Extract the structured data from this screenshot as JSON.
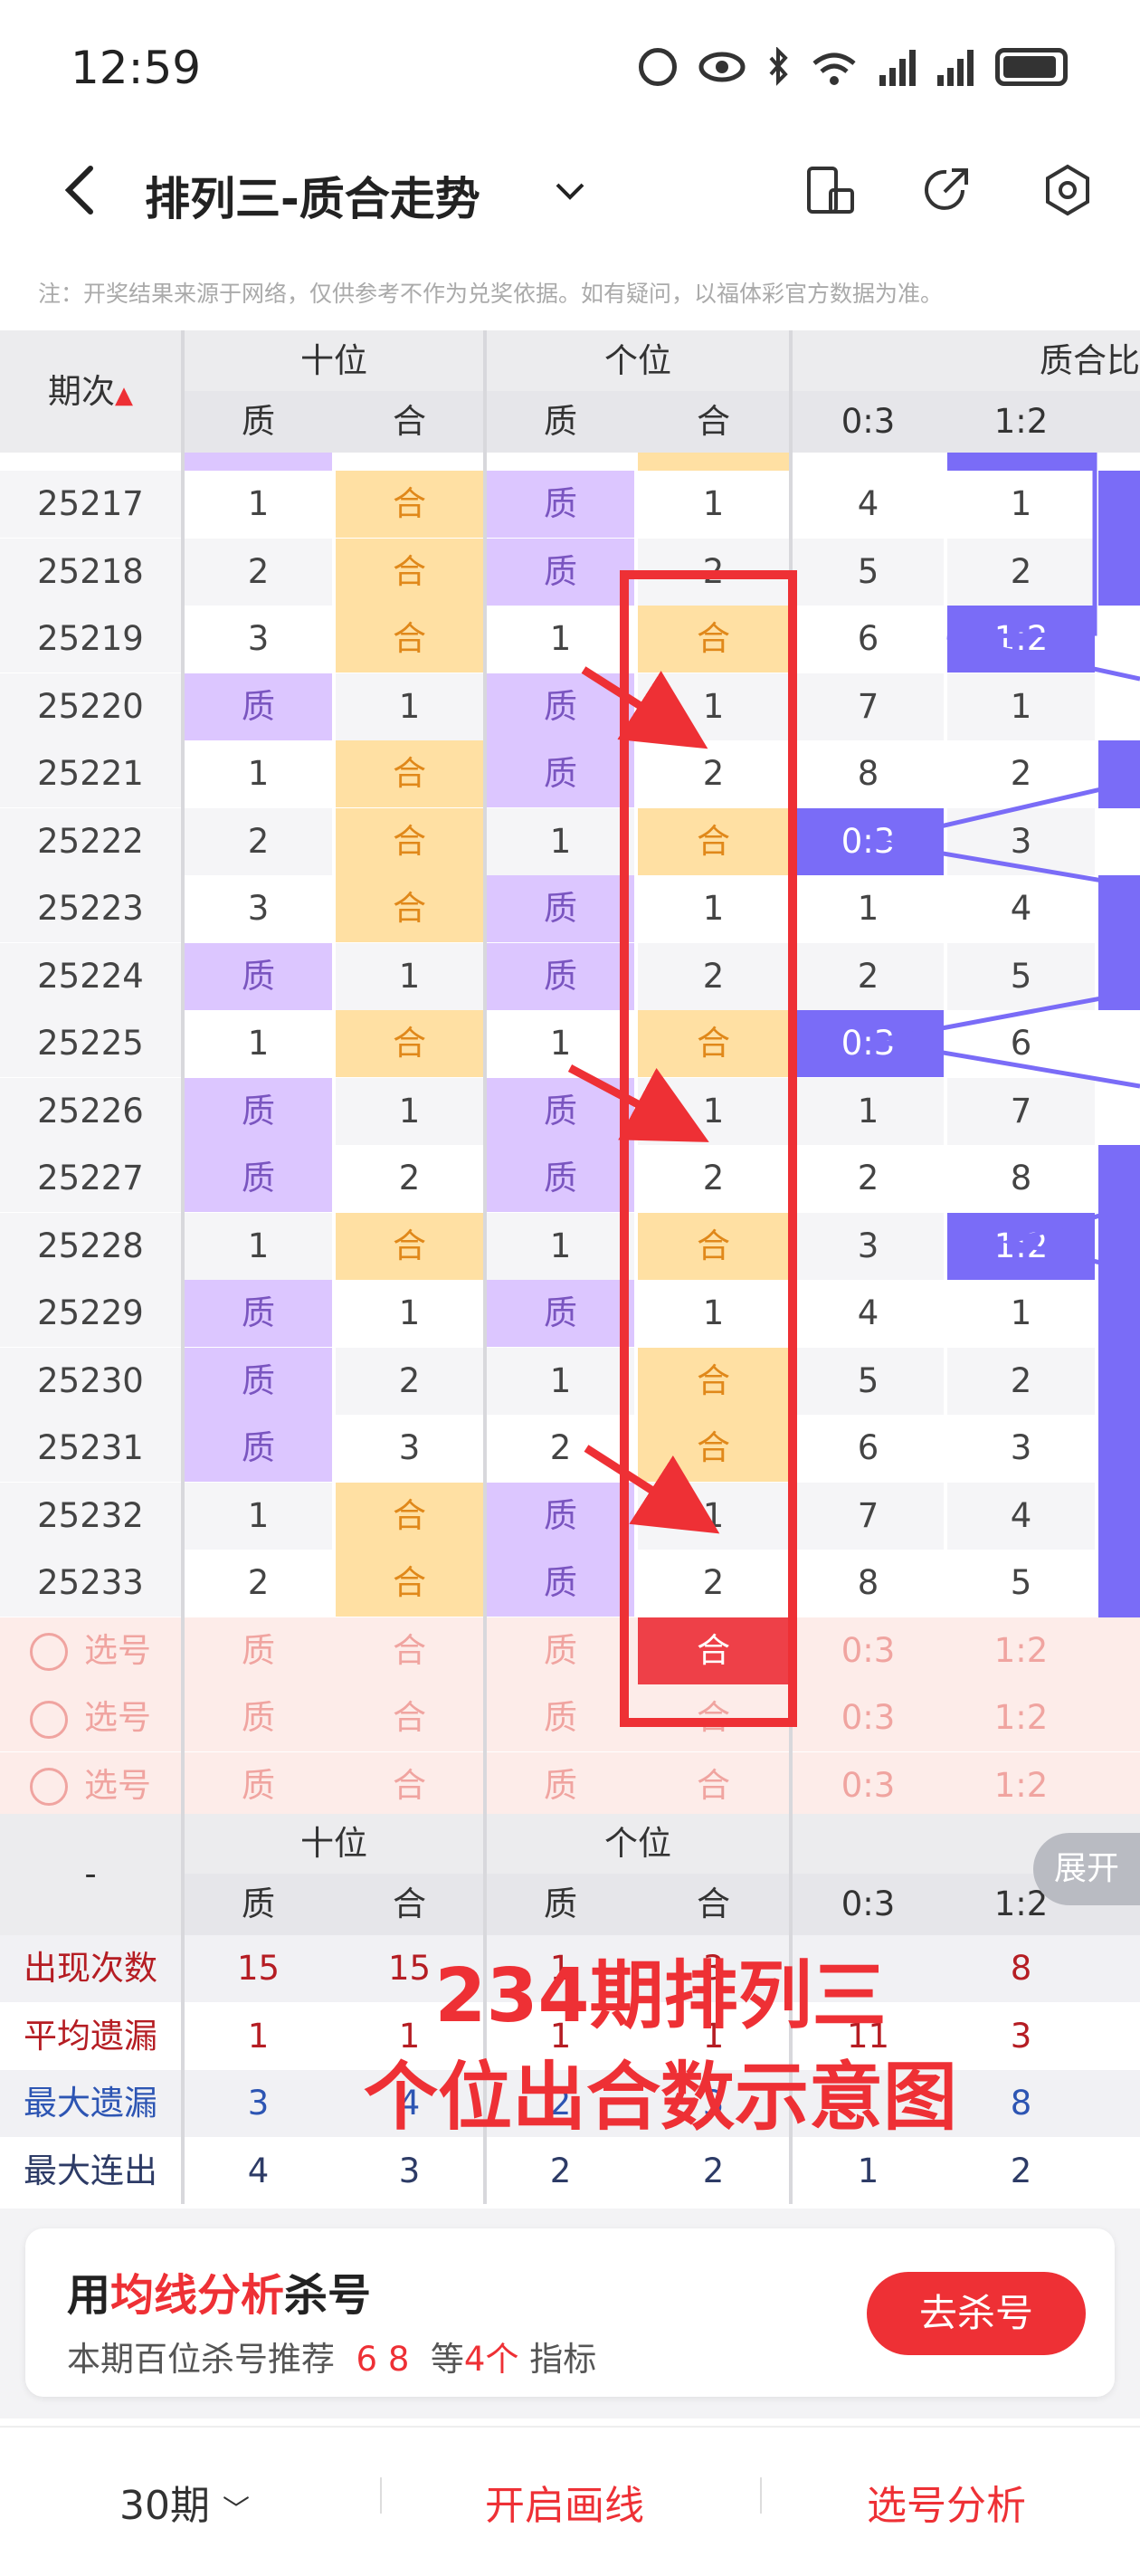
{
  "status": {
    "time": "12:59"
  },
  "header": {
    "title": "排列三-质合走势"
  },
  "notice": "注：开奖结果来源于网络，仅供参考不作为兑奖依据。如有疑问，以福体彩官方数据为准。",
  "table": {
    "period_header": "期次",
    "groups": [
      "十位",
      "个位",
      "质合比"
    ],
    "sub": [
      "质",
      "合",
      "质",
      "合",
      "0:3",
      "1:2"
    ],
    "rows": [
      [
        "25217",
        "1",
        "合",
        "质",
        "1",
        "4",
        "1"
      ],
      [
        "25218",
        "2",
        "合",
        "质",
        "2",
        "5",
        "2"
      ],
      [
        "25219",
        "3",
        "合",
        "1",
        "合",
        "6",
        "1:2"
      ],
      [
        "25220",
        "质",
        "1",
        "质",
        "1",
        "7",
        "1"
      ],
      [
        "25221",
        "1",
        "合",
        "质",
        "2",
        "8",
        "2"
      ],
      [
        "25222",
        "2",
        "合",
        "1",
        "合",
        "0:3",
        "3"
      ],
      [
        "25223",
        "3",
        "合",
        "质",
        "1",
        "1",
        "4"
      ],
      [
        "25224",
        "质",
        "1",
        "质",
        "2",
        "2",
        "5"
      ],
      [
        "25225",
        "1",
        "合",
        "1",
        "合",
        "0:3",
        "6"
      ],
      [
        "25226",
        "质",
        "1",
        "质",
        "1",
        "1",
        "7"
      ],
      [
        "25227",
        "质",
        "2",
        "质",
        "2",
        "2",
        "8"
      ],
      [
        "25228",
        "1",
        "合",
        "1",
        "合",
        "3",
        "1:2"
      ],
      [
        "25229",
        "质",
        "1",
        "质",
        "1",
        "4",
        "1"
      ],
      [
        "25230",
        "质",
        "2",
        "1",
        "合",
        "5",
        "2"
      ],
      [
        "25231",
        "质",
        "3",
        "2",
        "合",
        "6",
        "3"
      ],
      [
        "25232",
        "1",
        "合",
        "质",
        "1",
        "7",
        "4"
      ],
      [
        "25233",
        "2",
        "合",
        "质",
        "2",
        "8",
        "5"
      ]
    ],
    "select_label": "选号",
    "select_rows": [
      [
        "质",
        "合",
        "质",
        "合",
        "0:3",
        "1:2"
      ],
      [
        "质",
        "合",
        "质",
        "合",
        "0:3",
        "1:2"
      ],
      [
        "质",
        "合",
        "质",
        "合",
        "0:3",
        "1:2"
      ]
    ],
    "footer_dash": "-",
    "footer_groups": [
      "十位",
      "个位"
    ],
    "expand": "展开",
    "stats": [
      {
        "label": "出现次数",
        "values": [
          "15",
          "15",
          "1",
          "3",
          "",
          "8"
        ]
      },
      {
        "label": "平均遗漏",
        "values": [
          "1",
          "1",
          "1",
          "1",
          "11",
          "3"
        ]
      },
      {
        "label": "最大遗漏",
        "values": [
          "3",
          "4",
          "2",
          "3",
          "",
          "8"
        ]
      },
      {
        "label": "最大连出",
        "values": [
          "4",
          "3",
          "2",
          "2",
          "1",
          "2"
        ]
      }
    ]
  },
  "annotation": {
    "line1": "234期排列三",
    "line2": "个位出合数示意图"
  },
  "promo": {
    "prefix": "用",
    "highlight": "均线分析",
    "suffix": "杀号",
    "sub_prefix": "本期百位杀号推荐",
    "sub_nums": "6 8",
    "sub_mid": "等",
    "sub_count": "4个",
    "sub_suffix": "指标",
    "button": "去杀号"
  },
  "bottom": {
    "periods": "30期",
    "draw": "开启画线",
    "analysis": "选号分析"
  },
  "colors": {
    "accent": "#ee3035",
    "purple": "#7a6cf7",
    "zhi": "#dcc6ff",
    "he": "#ffe0a3"
  }
}
